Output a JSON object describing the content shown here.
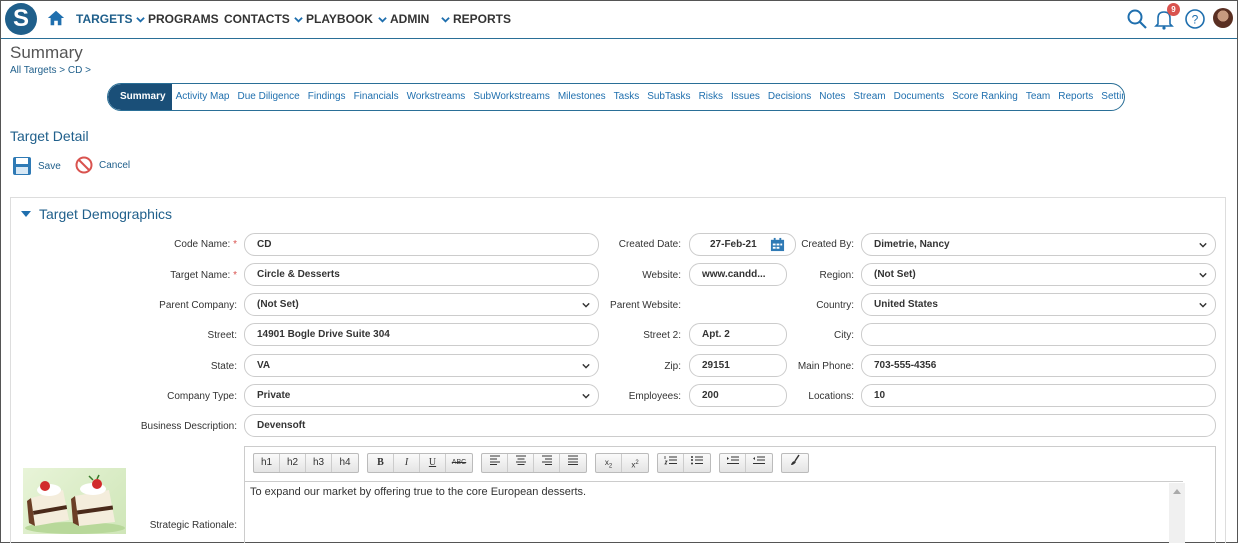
{
  "topnav": {
    "logo_letter": "S",
    "items": [
      {
        "label": "TARGETS",
        "active": true
      },
      {
        "label": "PROGRAMS",
        "dropdown": true
      },
      {
        "label": "CONTACTS"
      },
      {
        "label": "PLAYBOOK",
        "dropdown": true
      },
      {
        "label": "ADMIN",
        "dropdown": true
      },
      {
        "label": "REPORTS",
        "dropdown": true
      }
    ],
    "notification_count": "9"
  },
  "page": {
    "title": "Summary",
    "breadcrumb": [
      "All Targets",
      ">",
      "CD",
      ">"
    ]
  },
  "tabs": [
    "Summary",
    "Activity Map",
    "Due Diligence",
    "Findings",
    "Financials",
    "Workstreams",
    "SubWorkstreams",
    "Milestones",
    "Tasks",
    "SubTasks",
    "Risks",
    "Issues",
    "Decisions",
    "Notes",
    "Stream",
    "Documents",
    "Score Ranking",
    "Team",
    "Reports",
    "Settings"
  ],
  "detail": {
    "title": "Target Detail",
    "save_label": "Save",
    "cancel_label": "Cancel"
  },
  "demographics": {
    "title": "Target Demographics",
    "code_name_label": "Code Name:",
    "code_name": "CD",
    "target_name_label": "Target Name:",
    "target_name": "Circle & Desserts",
    "parent_company_label": "Parent Company:",
    "parent_company": "(Not Set)",
    "street_label": "Street:",
    "street": "14901 Bogle Drive Suite 304",
    "state_label": "State:",
    "state": "VA",
    "company_type_label": "Company Type:",
    "company_type": "Private",
    "business_description_label": "Business Description:",
    "business_description": "Devensoft",
    "created_date_label": "Created Date:",
    "created_date": "27-Feb-21",
    "website_label": "Website:",
    "website": "www.candd...",
    "parent_website_label": "Parent Website:",
    "street2_label": "Street 2:",
    "street2": "Apt. 2",
    "zip_label": "Zip:",
    "zip": "29151",
    "employees_label": "Employees:",
    "employees": "200",
    "created_by_label": "Created By:",
    "created_by": "Dimetrie, Nancy",
    "region_label": "Region:",
    "region": "(Not Set)",
    "country_label": "Country:",
    "country": "United States",
    "city_label": "City:",
    "city": "",
    "main_phone_label": "Main Phone:",
    "main_phone": "703-555-4356",
    "locations_label": "Locations:",
    "locations": "10",
    "strategic_rationale_label": "Strategic Rationale:",
    "strategic_rationale": "To expand our market by offering true to the core European desserts."
  },
  "editor": {
    "headings": [
      "h1",
      "h2",
      "h3",
      "h4"
    ],
    "format": [
      "B",
      "I",
      "U",
      "ABC"
    ],
    "colors": {
      "accent": "#1f5f8b",
      "tab_active": "#1a4f78",
      "required": "#d9534f"
    }
  }
}
